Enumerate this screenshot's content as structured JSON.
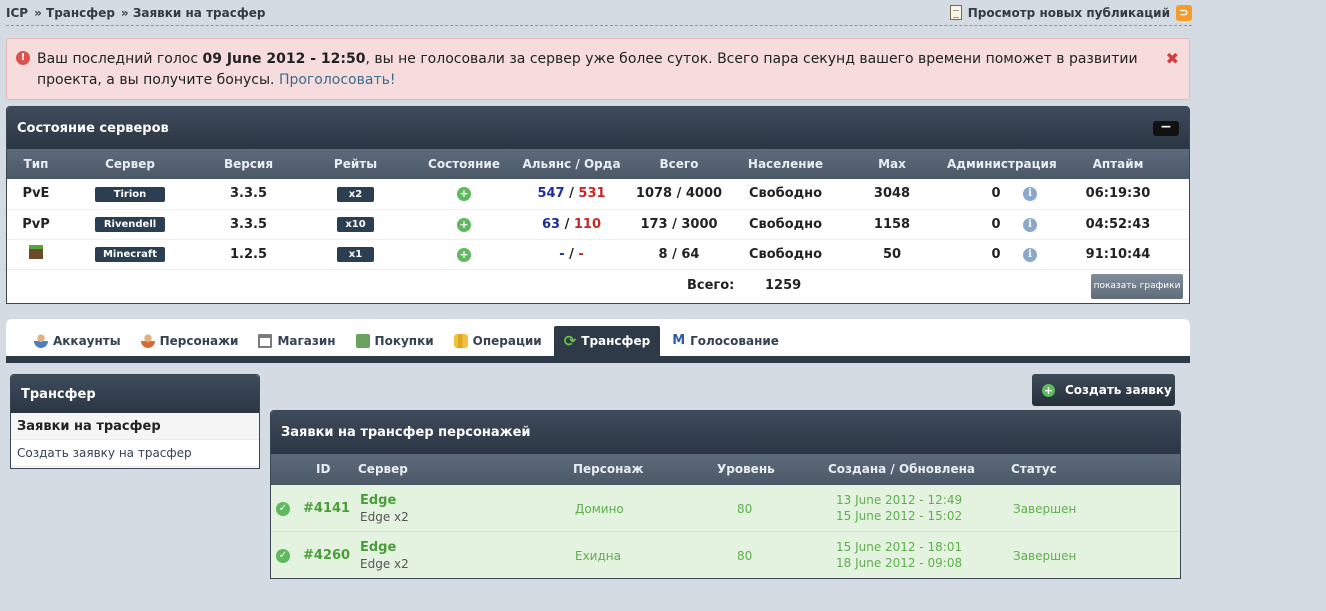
{
  "breadcrumb": {
    "items": [
      "ICP",
      "» Трансфер",
      "» Заявки на трасфер"
    ],
    "new_publications": "Просмотр новых публикаций"
  },
  "notice": {
    "text_before": "Ваш последний голос ",
    "date": "09 June 2012 - 12:50",
    "text_after": ", вы не голосовали за сервер уже более суток. Всего пара секунд вашего времени поможет в развитии проекта, а вы получите бонусы. ",
    "link": "Проголосовать!"
  },
  "servers": {
    "title": "Состояние серверов",
    "collapse_label": "−",
    "columns": [
      "Тип",
      "Сервер",
      "Версия",
      "Рейты",
      "Состояние",
      "Альянс / Орда",
      "Всего",
      "Население",
      "Max",
      "Администрация",
      "Аптайм"
    ],
    "rows": [
      {
        "type": "PvE",
        "server": "Tirion",
        "version": "3.3.5",
        "rate": "x2",
        "alliance": "547",
        "horde": "531",
        "total": "1078 / 4000",
        "population": "Свободно",
        "max": "3048",
        "admin": "0",
        "uptime": "06:19:30"
      },
      {
        "type": "PvP",
        "server": "Rivendell",
        "version": "3.3.5",
        "rate": "x10",
        "alliance": "63",
        "horde": "110",
        "total": "173 / 3000",
        "population": "Свободно",
        "max": "1158",
        "admin": "0",
        "uptime": "04:52:43"
      },
      {
        "type": "",
        "server": "Minecraft",
        "version": "1.2.5",
        "rate": "x1",
        "alliance": "-",
        "horde": "-",
        "total": "8 / 64",
        "population": "Свободно",
        "max": "50",
        "admin": "0",
        "uptime": "91:10:44"
      }
    ],
    "total_label": "Всего:",
    "total_value": "1259",
    "graphs_button": "показать графики"
  },
  "tabs": [
    {
      "label": "Аккаунты",
      "icon": "account-icon",
      "active": false
    },
    {
      "label": "Персонажи",
      "icon": "characters-icon",
      "active": false
    },
    {
      "label": "Магазин",
      "icon": "cart-icon",
      "active": false
    },
    {
      "label": "Покупки",
      "icon": "purchases-icon",
      "active": false
    },
    {
      "label": "Операции",
      "icon": "coins-icon",
      "active": false
    },
    {
      "label": "Трансфер",
      "icon": "transfer-icon",
      "active": true
    },
    {
      "label": "Голосование",
      "icon": "vote-icon",
      "active": false
    }
  ],
  "side": {
    "title": "Трансфер",
    "items": [
      "Заявки на трасфер",
      "Создать заявку на трасфер"
    ]
  },
  "create_button": "Создать заявку",
  "requests": {
    "title": "Заявки на трансфер персонажей",
    "columns": [
      "ID",
      "Сервер",
      "Персонаж",
      "Уровень",
      "Создана / Обновлена",
      "Статус"
    ],
    "rows": [
      {
        "id": "#4141",
        "server": "Edge",
        "server_sub": "Edge x2",
        "character": "Домино",
        "level": "80",
        "created": "13 June 2012 - 12:49",
        "updated": "15 June 2012 - 15:02",
        "status": "Завершен"
      },
      {
        "id": "#4260",
        "server": "Edge",
        "server_sub": "Edge x2",
        "character": "Ехидна",
        "level": "80",
        "created": "15 June 2012 - 18:01",
        "updated": "18 June 2012 - 09:08",
        "status": "Завершен"
      }
    ]
  },
  "colors": {
    "alliance": "#1d2e9a",
    "horde": "#c62828",
    "complete": "#5fae4e",
    "panel_header": "#2e3a47"
  }
}
